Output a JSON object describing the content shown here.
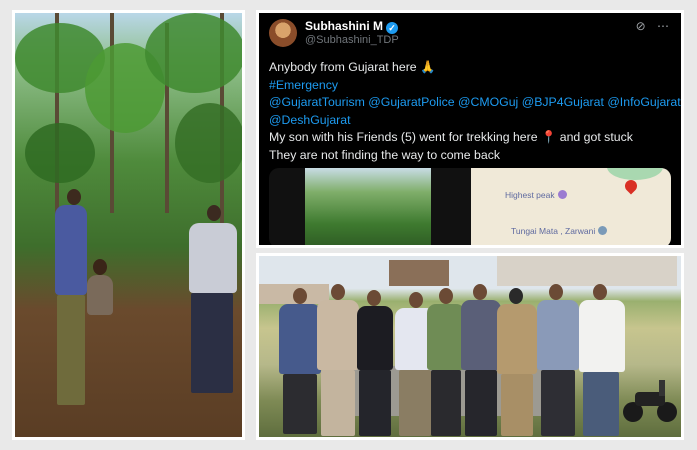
{
  "tweet": {
    "author_name": "Subhashini M",
    "author_handle": "@Subhashini_TDP",
    "lines": [
      "Anybody from Gujarat here 🙏",
      "#Emergency",
      "@GujaratTourism @GujaratPolice @CMOGuj @BJP4Gujarat @InfoGujarat",
      "@DeshGujarat",
      "My son with his Friends (5) went for trekking here 📍 and got stuck",
      "They are not finding the way to come back"
    ],
    "map": {
      "label_peak": "Highest peak",
      "label_temple": "Tungai Mata , Zarwani"
    }
  },
  "icons": {
    "verified": "verified-badge-icon",
    "grok": "grok-icon",
    "more": "more-options-icon"
  },
  "colors": {
    "tweet_bg": "#000000",
    "link": "#1d9bf0",
    "frame": "#ffffff"
  }
}
